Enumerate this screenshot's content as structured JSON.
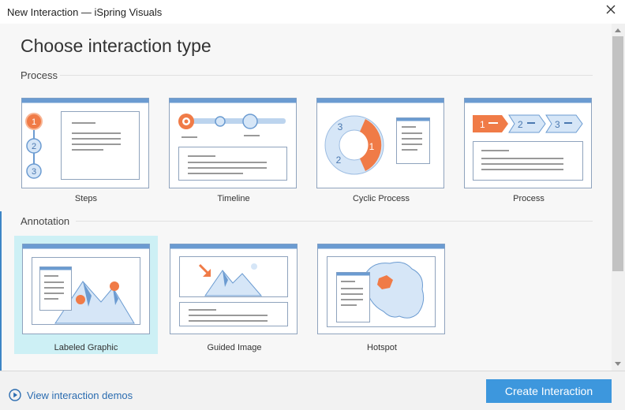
{
  "window": {
    "title": "New Interaction — iSpring Visuals",
    "close_icon": "close-icon"
  },
  "heading": "Choose interaction type",
  "sections": [
    {
      "label": "Process",
      "items": [
        "Steps",
        "Timeline",
        "Cyclic Process",
        "Process"
      ]
    },
    {
      "label": "Annotation",
      "items": [
        "Labeled Graphic",
        "Guided Image",
        "Hotspot"
      ]
    }
  ],
  "selected_item": "Labeled Graphic",
  "footer": {
    "demo_link": "View interaction demos",
    "create_button": "Create Interaction"
  },
  "colors": {
    "accent": "#3d97dd",
    "selection": "#cdf0f5",
    "thumb_orange": "#f07b47",
    "thumb_blue": "#6b9bd1"
  }
}
